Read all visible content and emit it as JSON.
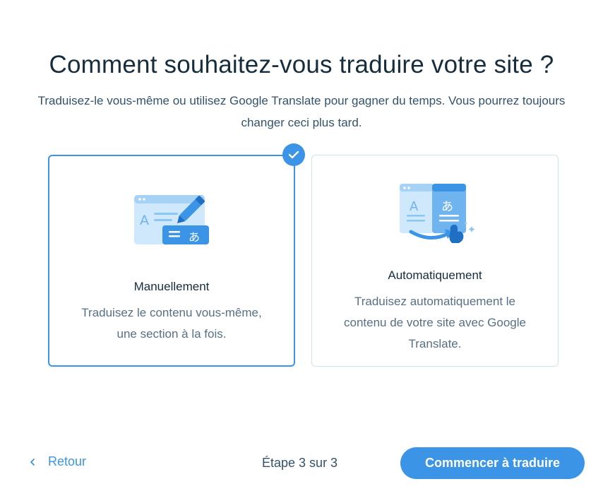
{
  "header": {
    "title": "Comment souhaitez-vous traduire votre site ?",
    "subtitle_line1": "Traduisez-le vous-même ou utilisez Google Translate pour gagner du temps. Vous pourrez toujours",
    "subtitle_line2": "changer ceci plus tard."
  },
  "options": {
    "manual": {
      "title": "Manuellement",
      "desc_line1": "Traduisez le contenu vous-même,",
      "desc_line2": "une section à la fois.",
      "selected": true,
      "icon_left_glyph": "A",
      "icon_right_glyph": "あ"
    },
    "auto": {
      "title": "Automatiquement",
      "desc_line1": "Traduisez automatiquement le",
      "desc_line2": "contenu de votre site avec Google",
      "desc_line3": "Translate.",
      "selected": false,
      "icon_left_glyph": "A",
      "icon_right_glyph": "あ"
    }
  },
  "footer": {
    "back_label": "Retour",
    "step_label": "Étape 3 sur 3",
    "cta_label": "Commencer à traduire"
  },
  "icons": {
    "selected_check": "check-icon",
    "back": "chevron-left-icon",
    "manual_illustration": "manual-translate-illustration-icon",
    "auto_illustration": "auto-translate-illustration-icon"
  },
  "colors": {
    "accent": "#3b94e6",
    "title": "#162d3d",
    "body_text": "#577083",
    "card_border": "#cfe2ef"
  }
}
